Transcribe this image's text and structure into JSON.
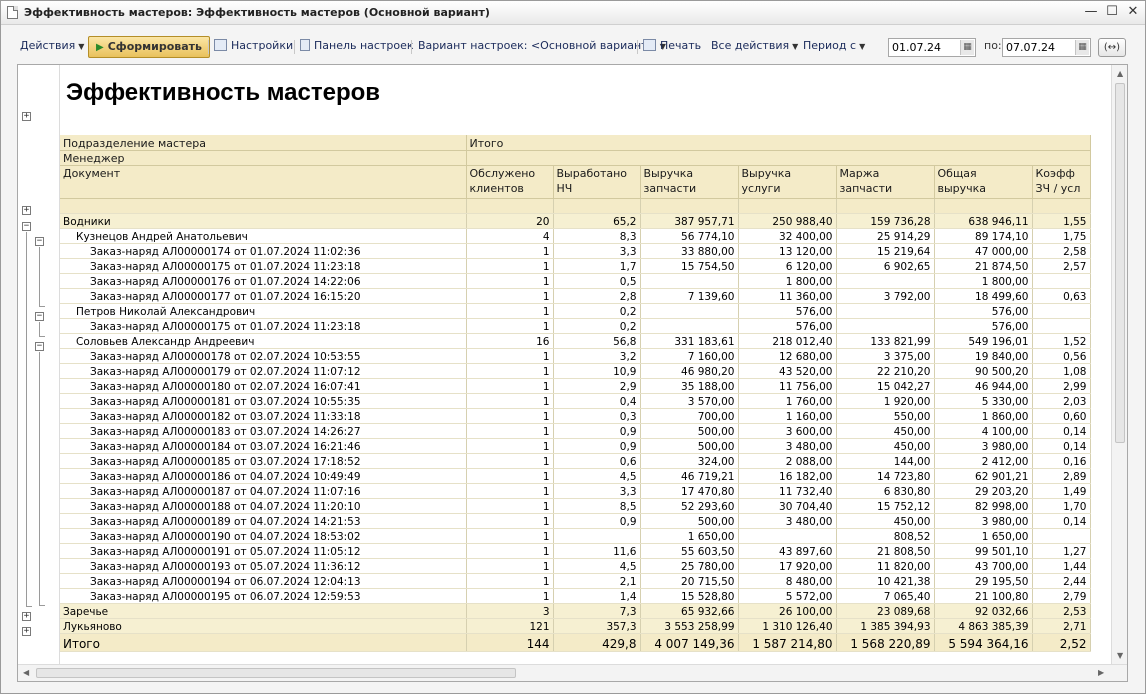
{
  "window": {
    "title": "Эффективность мастеров: Эффективность мастеров (Основной вариант)"
  },
  "toolbar": {
    "actions": "Действия",
    "generate": "Сформировать",
    "settings": "Настройки",
    "settings_panel": "Панель настроек",
    "variant": "Вариант настроек: <Основной вариант>",
    "print": "Печать",
    "all_actions": "Все действия",
    "period_from_label": "Период с",
    "date_from": "01.07.24",
    "to_label": "по:",
    "date_to": "07.07.24",
    "refresh": "(↔)"
  },
  "report": {
    "title": "Эффективность мастеров",
    "headers": {
      "row_dim1": "Подразделение мастера",
      "row_dim2": "Менеджер",
      "row_dim3": "Документ",
      "col_group": "Итого",
      "columns": [
        [
          "Обслужено",
          "клиентов"
        ],
        [
          "Выработано",
          "НЧ"
        ],
        [
          "Выручка",
          "запчасти"
        ],
        [
          "Выручка",
          "услуги"
        ],
        [
          "Маржа",
          "запчасти"
        ],
        [
          "Общая",
          "выручка"
        ],
        [
          "Коэфф",
          "ЗЧ / усл"
        ]
      ]
    },
    "rows": [
      {
        "level": "grp",
        "label": "Водники",
        "values": [
          "20",
          "65,2",
          "387 957,71",
          "250 988,40",
          "159 736,28",
          "638 946,11",
          "1,55"
        ]
      },
      {
        "level": "sub",
        "label": "Кузнецов Андрей Анатольевич",
        "values": [
          "4",
          "8,3",
          "56 774,10",
          "32 400,00",
          "25 914,29",
          "89 174,10",
          "1,75"
        ]
      },
      {
        "level": "doc",
        "label": "Заказ-наряд АЛ00000174 от 01.07.2024 11:02:36",
        "values": [
          "1",
          "3,3",
          "33 880,00",
          "13 120,00",
          "15 219,64",
          "47 000,00",
          "2,58"
        ]
      },
      {
        "level": "doc",
        "label": "Заказ-наряд АЛ00000175 от 01.07.2024 11:23:18",
        "values": [
          "1",
          "1,7",
          "15 754,50",
          "6 120,00",
          "6 902,65",
          "21 874,50",
          "2,57"
        ]
      },
      {
        "level": "doc",
        "label": "Заказ-наряд АЛ00000176 от 01.07.2024 14:22:06",
        "values": [
          "1",
          "0,5",
          "",
          "1 800,00",
          "",
          "1 800,00",
          ""
        ]
      },
      {
        "level": "doc",
        "label": "Заказ-наряд АЛ00000177 от 01.07.2024 16:15:20",
        "values": [
          "1",
          "2,8",
          "7 139,60",
          "11 360,00",
          "3 792,00",
          "18 499,60",
          "0,63"
        ]
      },
      {
        "level": "sub",
        "label": "Петров Николай Александрович",
        "values": [
          "1",
          "0,2",
          "",
          "576,00",
          "",
          "576,00",
          ""
        ]
      },
      {
        "level": "doc",
        "label": "Заказ-наряд АЛ00000175 от 01.07.2024 11:23:18",
        "values": [
          "1",
          "0,2",
          "",
          "576,00",
          "",
          "576,00",
          ""
        ]
      },
      {
        "level": "sub",
        "label": "Соловьев Александр Андреевич",
        "values": [
          "16",
          "56,8",
          "331 183,61",
          "218 012,40",
          "133 821,99",
          "549 196,01",
          "1,52"
        ]
      },
      {
        "level": "doc",
        "label": "Заказ-наряд АЛ00000178 от 02.07.2024 10:53:55",
        "values": [
          "1",
          "3,2",
          "7 160,00",
          "12 680,00",
          "3 375,00",
          "19 840,00",
          "0,56"
        ]
      },
      {
        "level": "doc",
        "label": "Заказ-наряд АЛ00000179 от 02.07.2024 11:07:12",
        "values": [
          "1",
          "10,9",
          "46 980,20",
          "43 520,00",
          "22 210,20",
          "90 500,20",
          "1,08"
        ]
      },
      {
        "level": "doc",
        "label": "Заказ-наряд АЛ00000180 от 02.07.2024 16:07:41",
        "values": [
          "1",
          "2,9",
          "35 188,00",
          "11 756,00",
          "15 042,27",
          "46 944,00",
          "2,99"
        ]
      },
      {
        "level": "doc",
        "label": "Заказ-наряд АЛ00000181 от 03.07.2024 10:55:35",
        "values": [
          "1",
          "0,4",
          "3 570,00",
          "1 760,00",
          "1 920,00",
          "5 330,00",
          "2,03"
        ]
      },
      {
        "level": "doc",
        "label": "Заказ-наряд АЛ00000182 от 03.07.2024 11:33:18",
        "values": [
          "1",
          "0,3",
          "700,00",
          "1 160,00",
          "550,00",
          "1 860,00",
          "0,60"
        ]
      },
      {
        "level": "doc",
        "label": "Заказ-наряд АЛ00000183 от 03.07.2024 14:26:27",
        "values": [
          "1",
          "0,9",
          "500,00",
          "3 600,00",
          "450,00",
          "4 100,00",
          "0,14"
        ]
      },
      {
        "level": "doc",
        "label": "Заказ-наряд АЛ00000184 от 03.07.2024 16:21:46",
        "values": [
          "1",
          "0,9",
          "500,00",
          "3 480,00",
          "450,00",
          "3 980,00",
          "0,14"
        ]
      },
      {
        "level": "doc",
        "label": "Заказ-наряд АЛ00000185 от 03.07.2024 17:18:52",
        "values": [
          "1",
          "0,6",
          "324,00",
          "2 088,00",
          "144,00",
          "2 412,00",
          "0,16"
        ]
      },
      {
        "level": "doc",
        "label": "Заказ-наряд АЛ00000186 от 04.07.2024 10:49:49",
        "values": [
          "1",
          "4,5",
          "46 719,21",
          "16 182,00",
          "14 723,80",
          "62 901,21",
          "2,89"
        ]
      },
      {
        "level": "doc",
        "label": "Заказ-наряд АЛ00000187 от 04.07.2024 11:07:16",
        "values": [
          "1",
          "3,3",
          "17 470,80",
          "11 732,40",
          "6 830,80",
          "29 203,20",
          "1,49"
        ]
      },
      {
        "level": "doc",
        "label": "Заказ-наряд АЛ00000188 от 04.07.2024 11:20:10",
        "values": [
          "1",
          "8,5",
          "52 293,60",
          "30 704,40",
          "15 752,12",
          "82 998,00",
          "1,70"
        ]
      },
      {
        "level": "doc",
        "label": "Заказ-наряд АЛ00000189 от 04.07.2024 14:21:53",
        "values": [
          "1",
          "0,9",
          "500,00",
          "3 480,00",
          "450,00",
          "3 980,00",
          "0,14"
        ]
      },
      {
        "level": "doc",
        "label": "Заказ-наряд АЛ00000190 от 04.07.2024 18:53:02",
        "values": [
          "1",
          "",
          "1 650,00",
          "",
          "808,52",
          "1 650,00",
          ""
        ]
      },
      {
        "level": "doc",
        "label": "Заказ-наряд АЛ00000191 от 05.07.2024 11:05:12",
        "values": [
          "1",
          "11,6",
          "55 603,50",
          "43 897,60",
          "21 808,50",
          "99 501,10",
          "1,27"
        ]
      },
      {
        "level": "doc",
        "label": "Заказ-наряд АЛ00000193 от 05.07.2024 11:36:12",
        "values": [
          "1",
          "4,5",
          "25 780,00",
          "17 920,00",
          "11 820,00",
          "43 700,00",
          "1,44"
        ]
      },
      {
        "level": "doc",
        "label": "Заказ-наряд АЛ00000194 от 06.07.2024 12:04:13",
        "values": [
          "1",
          "2,1",
          "20 715,50",
          "8 480,00",
          "10 421,38",
          "29 195,50",
          "2,44"
        ]
      },
      {
        "level": "doc",
        "label": "Заказ-наряд АЛ00000195 от 06.07.2024 12:59:53",
        "values": [
          "1",
          "1,4",
          "15 528,80",
          "5 572,00",
          "7 065,40",
          "21 100,80",
          "2,79"
        ]
      },
      {
        "level": "grp",
        "label": "Заречье",
        "values": [
          "3",
          "7,3",
          "65 932,66",
          "26 100,00",
          "23 089,68",
          "92 032,66",
          "2,53"
        ]
      },
      {
        "level": "grp",
        "label": "Лукьяново",
        "values": [
          "121",
          "357,3",
          "3 553 258,99",
          "1 310 126,40",
          "1 385 394,93",
          "4 863 385,39",
          "2,71"
        ]
      }
    ],
    "total": {
      "label": "Итого",
      "values": [
        "144",
        "429,8",
        "4 007 149,36",
        "1 587 214,80",
        "1 568 220,89",
        "5 594 364,16",
        "2,52"
      ]
    }
  }
}
